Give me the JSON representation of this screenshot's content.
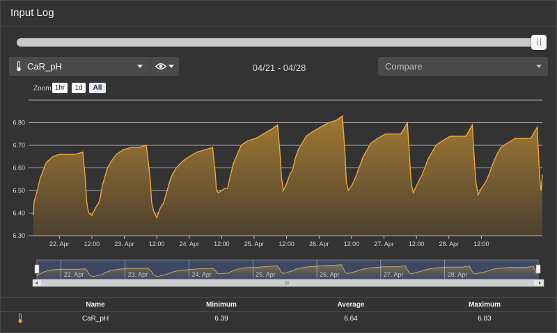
{
  "header": {
    "title": "Input Log"
  },
  "controls": {
    "time_slider_value": 1.0,
    "input_select": {
      "selected": "CaR_pH",
      "icon": "thermometer-icon"
    },
    "visibility_select": {
      "icon": "eye-icon"
    },
    "date_range": "04/21 - 04/28",
    "compare_select": {
      "placeholder": "Compare"
    },
    "zoom": {
      "label": "Zoom",
      "buttons": [
        "1hr",
        "1d",
        "All"
      ],
      "active": "All"
    }
  },
  "colors": {
    "series": "#f0a83a",
    "fill": "#9c7631",
    "background": "#333333",
    "navigator": "#3d4863"
  },
  "chart_data": {
    "type": "area",
    "x_ticks": [
      "22. Apr",
      "12:00",
      "23. Apr",
      "12:00",
      "24. Apr",
      "12:00",
      "25. Apr",
      "12:00",
      "26. Apr",
      "12:00",
      "27. Apr",
      "12:00",
      "28. Apr",
      "12:00"
    ],
    "y_ticks": [
      "6.30",
      "6.40",
      "6.50",
      "6.60",
      "6.70",
      "6.80"
    ],
    "ylim": [
      6.3,
      6.9
    ],
    "grid": true,
    "series": [
      {
        "name": "CaR_pH",
        "x": [
          0.0,
          0.01,
          0.03,
          0.06,
          0.1,
          0.14,
          0.19,
          0.22,
          0.3,
          0.4,
          0.52,
          0.64,
          0.76,
          0.8,
          0.82,
          0.85,
          0.9,
          0.95,
          0.99,
          1.0,
          1.03,
          1.06,
          1.1,
          1.14,
          1.2,
          1.28,
          1.38,
          1.5,
          1.62,
          1.74,
          1.8,
          1.82,
          1.85,
          1.9,
          1.95,
          1.99,
          2.0,
          2.03,
          2.06,
          2.1,
          2.14,
          2.2,
          2.3,
          2.4,
          2.52,
          2.64,
          2.76,
          2.8,
          2.82,
          2.85,
          2.9,
          2.95,
          2.99,
          3.0,
          3.03,
          3.08,
          3.14,
          3.2,
          3.3,
          3.42,
          3.54,
          3.66,
          3.76,
          3.8,
          3.82,
          3.85,
          3.9,
          3.95,
          3.99,
          4.0,
          4.03,
          4.08,
          4.14,
          4.2,
          4.3,
          4.42,
          4.54,
          4.66,
          4.76,
          4.8,
          4.82,
          4.85,
          4.9,
          4.95,
          4.99,
          5.0,
          5.03,
          5.08,
          5.14,
          5.2,
          5.3,
          5.42,
          5.54,
          5.66,
          5.76,
          5.8,
          5.82,
          5.85,
          5.9,
          5.95,
          5.99,
          6.0,
          6.03,
          6.08,
          6.14,
          6.2,
          6.3,
          6.42,
          6.54,
          6.66,
          6.76,
          6.8,
          6.82,
          6.85,
          6.9,
          6.95,
          6.99,
          7.0,
          7.03,
          7.08,
          7.14,
          7.2,
          7.3,
          7.42,
          7.54,
          7.66,
          7.76,
          7.8,
          7.82,
          7.84
        ],
        "values": [
          6.39,
          6.45,
          6.47,
          6.5,
          6.55,
          6.58,
          6.62,
          6.63,
          6.65,
          6.66,
          6.66,
          6.66,
          6.67,
          6.55,
          6.45,
          6.4,
          6.39,
          6.42,
          6.44,
          6.44,
          6.47,
          6.52,
          6.56,
          6.6,
          6.63,
          6.66,
          6.68,
          6.69,
          6.69,
          6.7,
          6.55,
          6.45,
          6.41,
          6.38,
          6.42,
          6.44,
          6.44,
          6.47,
          6.5,
          6.54,
          6.57,
          6.6,
          6.63,
          6.65,
          6.67,
          6.68,
          6.69,
          6.58,
          6.5,
          6.49,
          6.5,
          6.51,
          6.51,
          6.52,
          6.56,
          6.62,
          6.66,
          6.7,
          6.72,
          6.73,
          6.75,
          6.77,
          6.79,
          6.66,
          6.56,
          6.5,
          6.53,
          6.57,
          6.59,
          6.6,
          6.64,
          6.68,
          6.71,
          6.74,
          6.76,
          6.78,
          6.8,
          6.81,
          6.83,
          6.66,
          6.54,
          6.5,
          6.52,
          6.55,
          6.58,
          6.59,
          6.61,
          6.65,
          6.68,
          6.71,
          6.73,
          6.75,
          6.75,
          6.75,
          6.8,
          6.62,
          6.53,
          6.49,
          6.52,
          6.55,
          6.57,
          6.58,
          6.6,
          6.64,
          6.67,
          6.7,
          6.72,
          6.74,
          6.74,
          6.74,
          6.79,
          6.6,
          6.53,
          6.48,
          6.51,
          6.53,
          6.55,
          6.56,
          6.58,
          6.62,
          6.66,
          6.69,
          6.71,
          6.73,
          6.73,
          6.73,
          6.78,
          6.55,
          6.5,
          6.57
        ]
      }
    ]
  },
  "navigator": {
    "labels": [
      "22. Apr",
      "23. Apr",
      "24. Apr",
      "25. Apr",
      "26. Apr",
      "27. Apr",
      "28. Apr"
    ]
  },
  "stats_table": {
    "headers": [
      "Name",
      "Minimum",
      "Average",
      "Maximum"
    ],
    "rows": [
      {
        "icon": "thermometer-icon",
        "name": "CaR_pH",
        "minimum": "6.39",
        "average": "6.64",
        "maximum": "6.83"
      }
    ]
  }
}
